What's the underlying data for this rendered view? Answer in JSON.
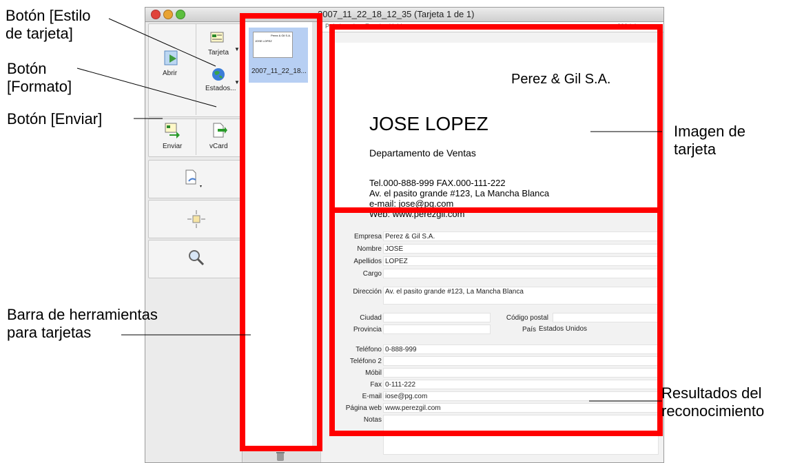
{
  "window": {
    "title": "2007_11_22_18_12_35 (Tarjeta 1 de 1)",
    "infobar_left": "P    de la tarjeta       Estados Unidos",
    "infobar_right": "300dpi"
  },
  "toolbar": {
    "open_label": "Abrir",
    "card_style_label": "Tarjeta",
    "format_label": "Estados...",
    "send_label": "Enviar",
    "vcard_label": "vCard"
  },
  "thumbnail": {
    "name": "2007_11_22_18...",
    "mini_company": "Perez & Gil S.A.",
    "mini_person": "JOSE LOPEZ"
  },
  "card": {
    "company": "Perez & Gil S.A.",
    "person": "JOSE LOPEZ",
    "department": "Departamento de Ventas",
    "phone_fax": "Tel.000-888-999    FAX.000-111-222",
    "address": "Av. el pasito grande #123, La Mancha Blanca",
    "email_label": "e-mail: ",
    "email": "jose@pg.com",
    "web": "Web: www.perezgil.com"
  },
  "form": {
    "labels": {
      "company": "Empresa",
      "first_name": "Nombre",
      "last_name": "Apellidos",
      "title": "Cargo",
      "address": "Dirección",
      "city": "Ciudad",
      "postal": "Código postal",
      "province": "Provincia",
      "country": "País",
      "phone": "Teléfono",
      "phone2": "Teléfono 2",
      "mobile": "Móbil",
      "fax": "Fax",
      "email": "E-mail",
      "web": "Página web",
      "notes": "Notas"
    },
    "values": {
      "company": "Perez & Gil S.A.",
      "first_name": "JOSE",
      "last_name": "LOPEZ",
      "title": "",
      "address": "Av. el pasito grande #123, La Mancha Blanca",
      "city": "",
      "postal": "",
      "province": "",
      "country": "Estados Unidos",
      "phone": "0-888-999",
      "phone2": "",
      "mobile": "",
      "fax": "0-111-222",
      "email": "iose@pg.com",
      "web": "www.perezgil.com",
      "notes": ""
    }
  },
  "callouts": {
    "card_style": "Botón [Estilo\nde tarjeta]",
    "format": "Botón\n[Formato]",
    "send": "Botón [Enviar]",
    "card_toolbar": "Barra de herramientas\npara tarjetas",
    "card_image": "Imagen de\ntarjeta",
    "results": "Resultados del\nreconocimiento"
  },
  "colors": {
    "highlight_red": "#ff0000",
    "selection_blue": "#b7cff3"
  }
}
